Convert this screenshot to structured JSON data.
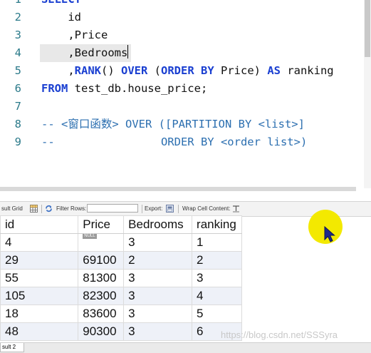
{
  "editor": {
    "lines": [
      {
        "num": "1",
        "tokens": [
          {
            "t": "SELECT",
            "c": "kw"
          }
        ]
      },
      {
        "num": "2",
        "tokens": [
          {
            "t": "    id",
            "c": ""
          }
        ]
      },
      {
        "num": "3",
        "tokens": [
          {
            "t": "    ,Price",
            "c": ""
          }
        ]
      },
      {
        "num": "4",
        "tokens": [
          {
            "t": "    ,Bedrooms",
            "c": ""
          }
        ],
        "current": true
      },
      {
        "num": "5",
        "tokens": [
          {
            "t": "    ,",
            "c": ""
          },
          {
            "t": "RANK",
            "c": "kw"
          },
          {
            "t": "() ",
            "c": ""
          },
          {
            "t": "OVER",
            "c": "kw"
          },
          {
            "t": " (",
            "c": ""
          },
          {
            "t": "ORDER BY",
            "c": "kw"
          },
          {
            "t": " Price) ",
            "c": ""
          },
          {
            "t": "AS",
            "c": "kw"
          },
          {
            "t": " ranking",
            "c": ""
          }
        ]
      },
      {
        "num": "6",
        "tokens": [
          {
            "t": "FROM",
            "c": "kw"
          },
          {
            "t": " test_db.house_price;",
            "c": ""
          }
        ]
      },
      {
        "num": "7",
        "tokens": []
      },
      {
        "num": "8",
        "tokens": [
          {
            "t": "-- <窗口函数> OVER ([PARTITION BY <list>]",
            "c": "cm"
          }
        ]
      },
      {
        "num": "9",
        "tokens": [
          {
            "t": "--                ORDER BY <order list>)",
            "c": "cm"
          }
        ]
      }
    ]
  },
  "toolbar": {
    "result_grid_label": "sult Grid",
    "filter_rows_label": "Filter Rows:",
    "filter_value": "",
    "export_label": "Export:",
    "wrap_label": "Wrap Cell Content:"
  },
  "grid": {
    "columns": [
      "id",
      "Price",
      "Bedrooms",
      "ranking"
    ],
    "null_badge": "NULL",
    "rows": [
      [
        "4",
        "",
        "3",
        "1"
      ],
      [
        "29",
        "69100",
        "2",
        "2"
      ],
      [
        "55",
        "81300",
        "3",
        "3"
      ],
      [
        "105",
        "82300",
        "3",
        "4"
      ],
      [
        "18",
        "83600",
        "3",
        "5"
      ],
      [
        "48",
        "90300",
        "3",
        "6"
      ]
    ]
  },
  "bottom": {
    "result_tab_label": "sult 2",
    "watermark": "https://blog.csdn.net/SSSyra"
  },
  "colors": {
    "keyword": "#1a3fd1",
    "comment": "#2c6fb0",
    "line_number": "#2b7a8a",
    "cursor_highlight": "#f3e900"
  }
}
